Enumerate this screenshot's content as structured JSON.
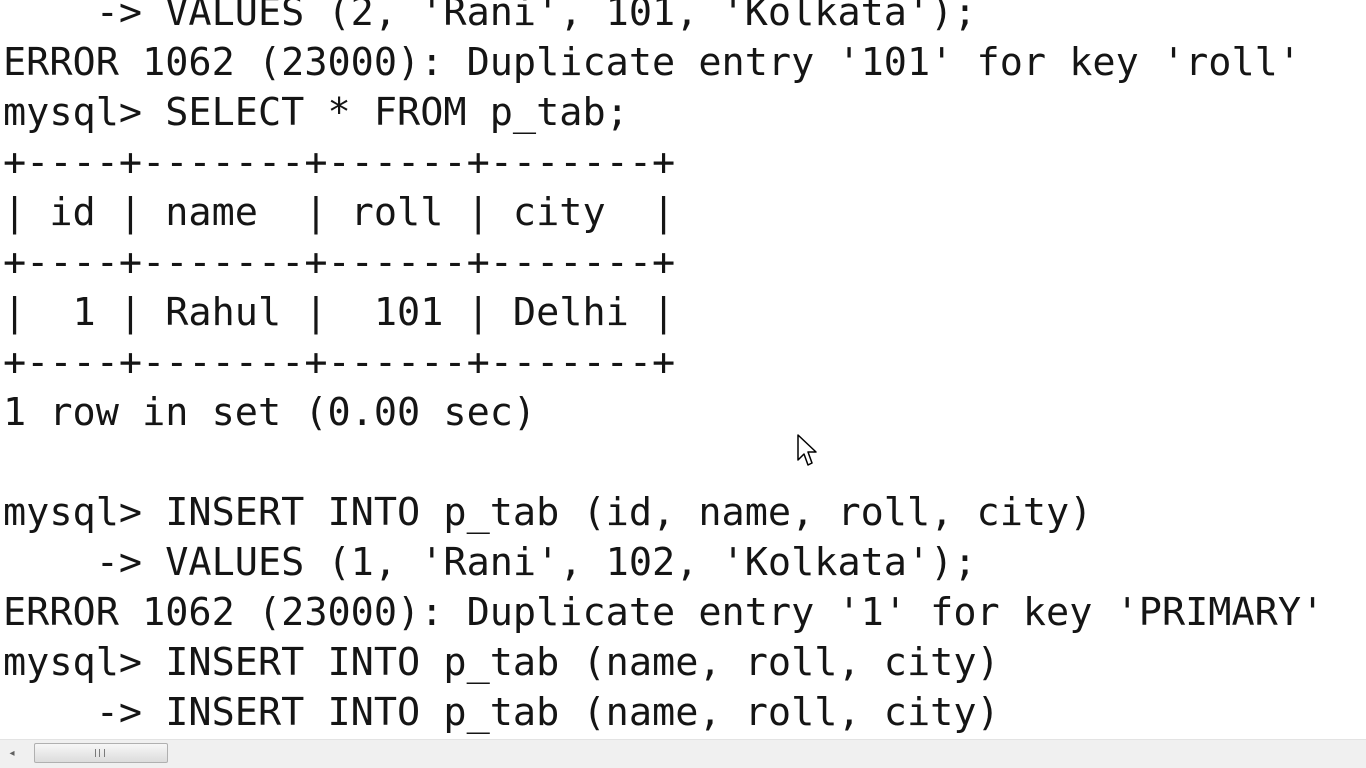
{
  "terminal": {
    "lines": [
      "    -> VALUES (2, 'Rani', 101, 'Kolkata');",
      "ERROR 1062 (23000): Duplicate entry '101' for key 'roll'",
      "mysql> SELECT * FROM p_tab;",
      "+----+-------+------+-------+",
      "| id | name  | roll | city  |",
      "+----+-------+------+-------+",
      "|  1 | Rahul |  101 | Delhi |",
      "+----+-------+------+-------+",
      "1 row in set (0.00 sec)",
      "",
      "mysql> INSERT INTO p_tab (id, name, roll, city)",
      "    -> VALUES (1, 'Rani', 102, 'Kolkata');",
      "ERROR 1062 (23000): Duplicate entry '1' for key 'PRIMARY'",
      "mysql> INSERT INTO p_tab (name, roll, city)",
      "    -> INSERT INTO p_tab (name, roll, city)"
    ]
  },
  "scrollbar": {
    "left_arrow_icon": "chevron-left-icon",
    "left_arrow_glyph": "◂",
    "thumb_grip_icon": "grip-icon"
  },
  "cursor": {
    "icon": "mouse-pointer-icon"
  },
  "colors": {
    "text": "#151515",
    "background": "#ffffff",
    "scrollbar_track": "#f0f0f0"
  }
}
